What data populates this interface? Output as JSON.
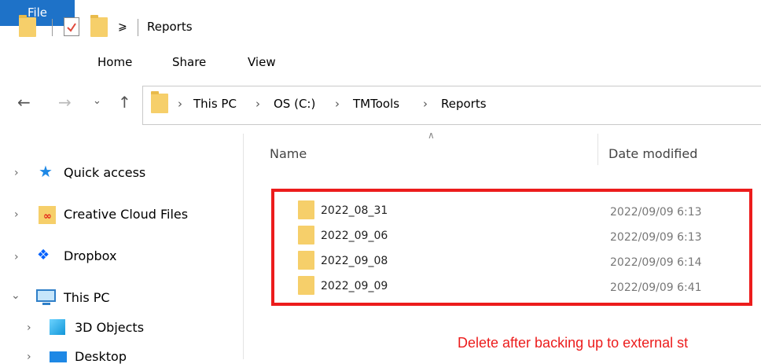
{
  "window": {
    "title": "Reports"
  },
  "ribbon": {
    "tabs": [
      {
        "label": "File"
      },
      {
        "label": "Home"
      },
      {
        "label": "Share"
      },
      {
        "label": "View"
      }
    ]
  },
  "address": {
    "breadcrumb": [
      "This PC",
      "OS (C:)",
      "TMTools",
      "Reports"
    ]
  },
  "nav_pane": {
    "items": [
      {
        "label": "Quick access",
        "icon": "star-icon"
      },
      {
        "label": "Creative Cloud Files",
        "icon": "creative-cloud-icon"
      },
      {
        "label": "Dropbox",
        "icon": "dropbox-icon"
      },
      {
        "label": "This PC",
        "icon": "monitor-icon"
      },
      {
        "label": "3D Objects",
        "icon": "cube-icon"
      },
      {
        "label": "Desktop",
        "icon": "desktop-icon"
      }
    ]
  },
  "file_list": {
    "columns": {
      "name": "Name",
      "date_modified": "Date modified"
    },
    "rows": [
      {
        "name": "2022_08_31",
        "date": "2022/09/09 6:13"
      },
      {
        "name": "2022_09_06",
        "date": "2022/09/09 6:13"
      },
      {
        "name": "2022_09_08",
        "date": "2022/09/09 6:14"
      },
      {
        "name": "2022_09_09",
        "date": "2022/09/09 6:41"
      }
    ]
  },
  "annotation": {
    "text": "Delete after backing up to external st"
  },
  "colors": {
    "accent": "#1e72c8",
    "annotation": "#ec1c1c",
    "folder": "#f6cf6a"
  }
}
